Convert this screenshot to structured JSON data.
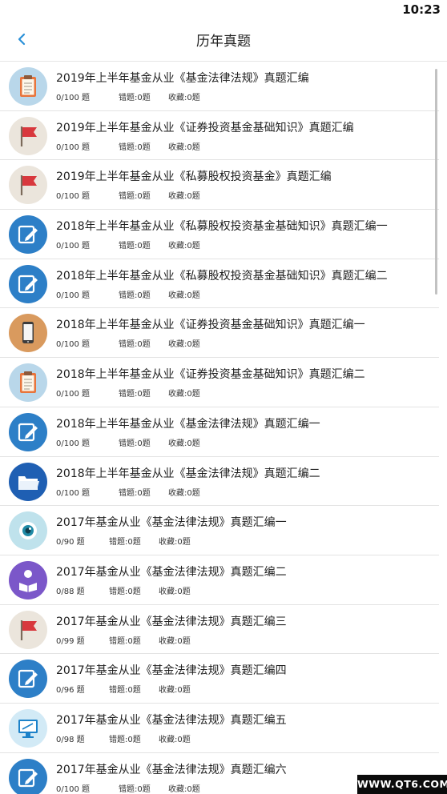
{
  "status": {
    "time": "10:23"
  },
  "header": {
    "title": "历年真题"
  },
  "items": [
    {
      "title": "2019年上半年基金从业《基金法律法规》真题汇编",
      "progress": "0/100 题",
      "wrong": "错题:0题",
      "fav": "收藏:0题",
      "icon": "clipboard-icon"
    },
    {
      "title": "2019年上半年基金从业《证券投资基金基础知识》真题汇编",
      "progress": "0/100 题",
      "wrong": "错题:0题",
      "fav": "收藏:0题",
      "icon": "flag-icon"
    },
    {
      "title": "2019年上半年基金从业《私募股权投资基金》真题汇编",
      "progress": "0/100 题",
      "wrong": "错题:0题",
      "fav": "收藏:0题",
      "icon": "flag-icon"
    },
    {
      "title": "2018年上半年基金从业《私募股权投资基金基础知识》真题汇编一",
      "progress": "0/100 题",
      "wrong": "错题:0题",
      "fav": "收藏:0题",
      "icon": "edit-icon"
    },
    {
      "title": "2018年上半年基金从业《私募股权投资基金基础知识》真题汇编二",
      "progress": "0/100 题",
      "wrong": "错题:0题",
      "fav": "收藏:0题",
      "icon": "edit-icon"
    },
    {
      "title": "2018年上半年基金从业《证券投资基金基础知识》真题汇编一",
      "progress": "0/100 题",
      "wrong": "错题:0题",
      "fav": "收藏:0题",
      "icon": "phone-icon"
    },
    {
      "title": "2018年上半年基金从业《证券投资基金基础知识》真题汇编二",
      "progress": "0/100 题",
      "wrong": "错题:0题",
      "fav": "收藏:0题",
      "icon": "clipboard-icon"
    },
    {
      "title": "2018年上半年基金从业《基金法律法规》真题汇编一",
      "progress": "0/100 题",
      "wrong": "错题:0题",
      "fav": "收藏:0题",
      "icon": "edit-icon"
    },
    {
      "title": "2018年上半年基金从业《基金法律法规》真题汇编二",
      "progress": "0/100 题",
      "wrong": "错题:0题",
      "fav": "收藏:0题",
      "icon": "folder-icon"
    },
    {
      "title": "2017年基金从业《基金法律法规》真题汇编一",
      "progress": "0/90 题",
      "wrong": "错题:0题",
      "fav": "收藏:0题",
      "icon": "eye-icon"
    },
    {
      "title": " 2017年基金从业《基金法律法规》真题汇编二",
      "progress": "0/88 题",
      "wrong": "错题:0题",
      "fav": "收藏:0题",
      "icon": "reader-icon"
    },
    {
      "title": "2017年基金从业《基金法律法规》真题汇编三",
      "progress": "0/99 题",
      "wrong": "错题:0题",
      "fav": "收藏:0题",
      "icon": "flag-icon"
    },
    {
      "title": "2017年基金从业《基金法律法规》真题汇编四",
      "progress": "0/96 题",
      "wrong": "错题:0题",
      "fav": "收藏:0题",
      "icon": "edit-icon"
    },
    {
      "title": "2017年基金从业《基金法律法规》真题汇编五",
      "progress": "0/98 题",
      "wrong": "错题:0题",
      "fav": "收藏:0题",
      "icon": "monitor-icon"
    },
    {
      "title": "2017年基金从业《基金法律法规》真题汇编六",
      "progress": "0/100 题",
      "wrong": "错题:0题",
      "fav": "收藏:0题",
      "icon": "edit-icon"
    }
  ],
  "watermark": "WWW.QT6.COM"
}
